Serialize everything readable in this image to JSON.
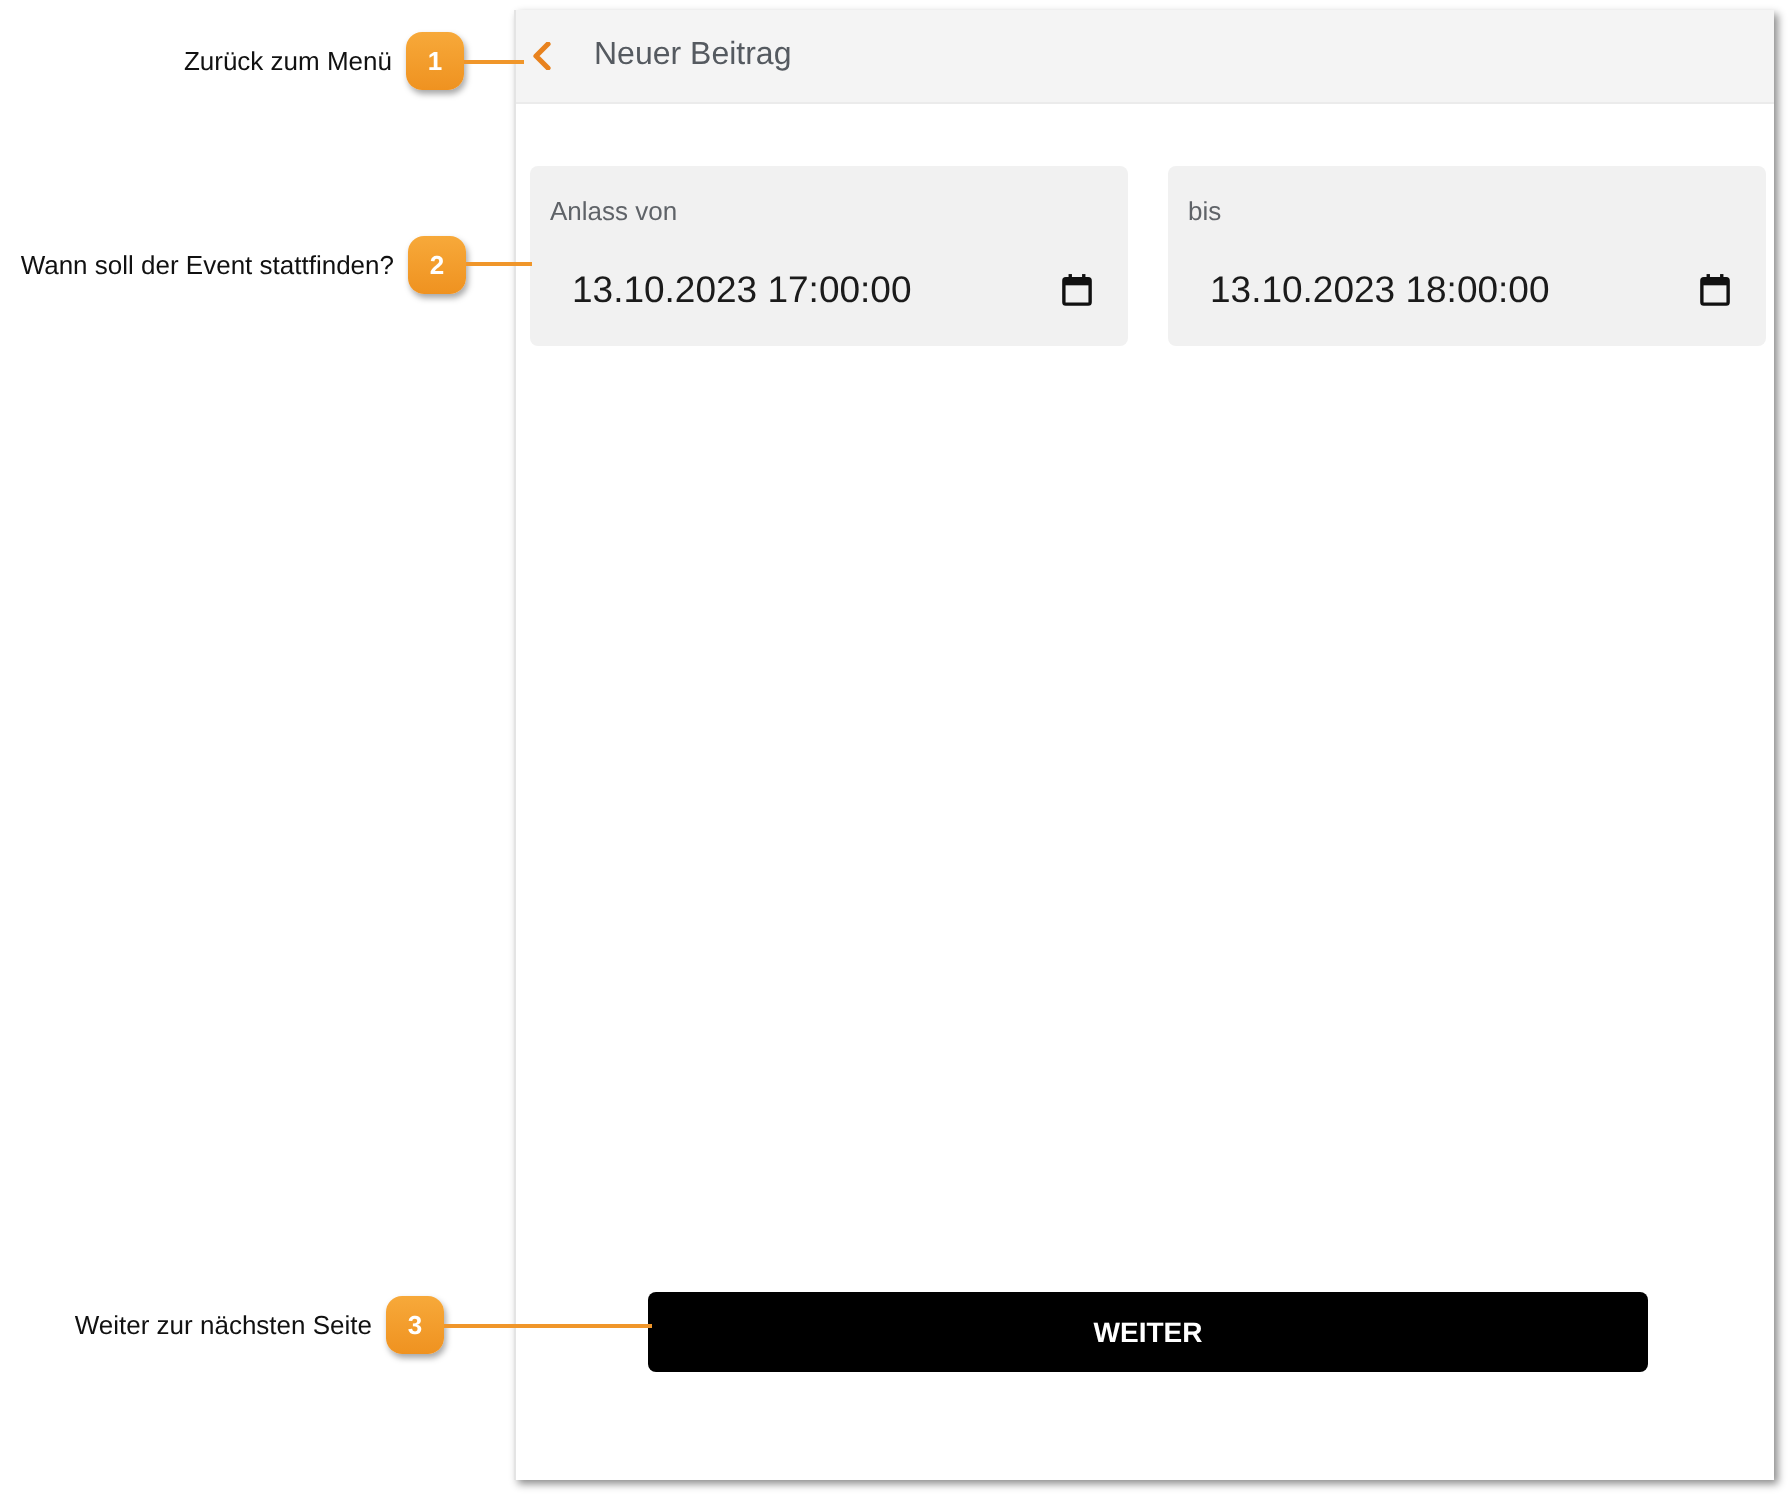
{
  "callouts": [
    {
      "number": "1",
      "text": "Zurück zum Menü"
    },
    {
      "number": "2",
      "text": "Wann soll der Event stattfinden?"
    },
    {
      "number": "3",
      "text": "Weiter zur nächsten Seite"
    }
  ],
  "header": {
    "title": "Neuer Beitrag"
  },
  "fields": [
    {
      "label": "Anlass von",
      "value": "13.10.2023 17:00:00"
    },
    {
      "label": "bis",
      "value": "13.10.2023 18:00:00"
    }
  ],
  "button": {
    "label": "WEITER"
  }
}
